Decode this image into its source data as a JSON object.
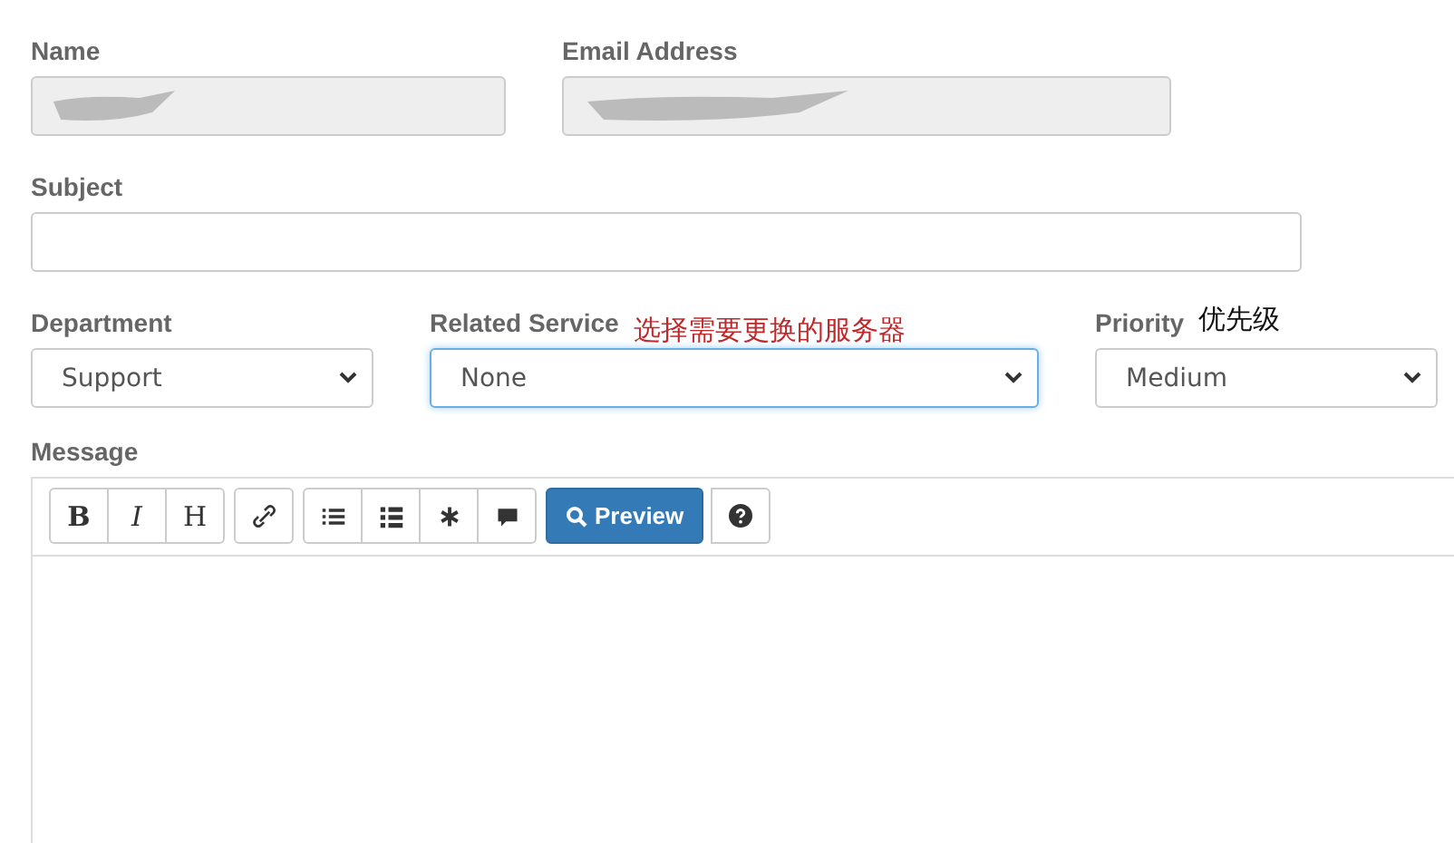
{
  "fields_top": [
    {
      "label": "Name",
      "redacted": true,
      "disabled": true
    },
    {
      "label": "Email Address",
      "redacted": true,
      "disabled": true
    }
  ],
  "subject": {
    "label": "Subject"
  },
  "selects": [
    {
      "label": "Department",
      "value": "Support",
      "focused": false
    },
    {
      "label": "Related Service",
      "value": "None",
      "focused": true,
      "note": "选择需要更换的服务器",
      "color": "#c0282b"
    },
    {
      "label": "Priority",
      "value": "Medium",
      "focused": false,
      "note": "优先级",
      "color": "#111111"
    }
  ],
  "message": {
    "label": "Message",
    "toolbar": [
      [
        {
          "kind": "bold",
          "text": "B"
        },
        {
          "kind": "italic",
          "text": "I"
        },
        {
          "kind": "heading",
          "text": "H"
        }
      ],
      [
        {
          "kind": "link"
        }
      ],
      [
        {
          "kind": "bullets"
        },
        {
          "kind": "numbers"
        },
        {
          "kind": "asterisk"
        },
        {
          "kind": "comment"
        }
      ]
    ],
    "preview": {
      "text": "Preview"
    }
  }
}
